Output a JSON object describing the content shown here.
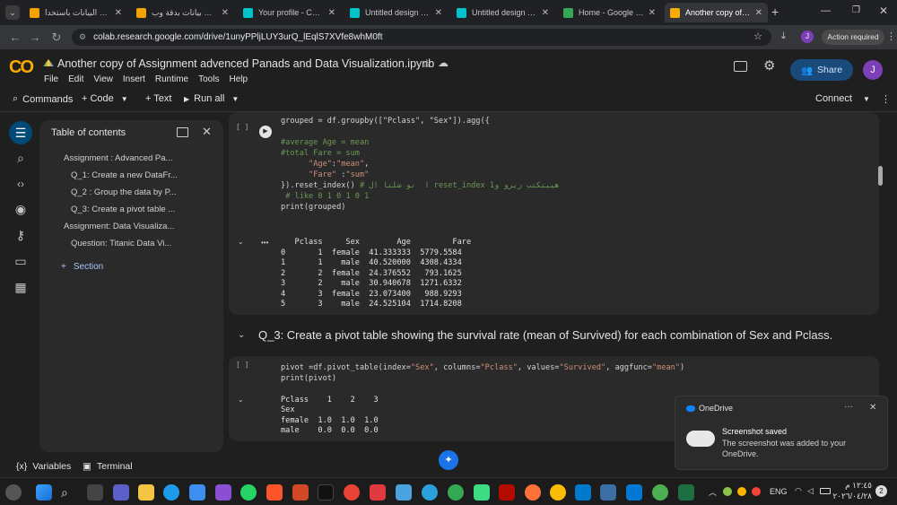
{
  "browser": {
    "tabs": [
      {
        "label": "تحليل البيانات باستخدا",
        "active": false,
        "favColor": "#f4a300"
      },
      {
        "label": "إدخال بيانات بدقة وب",
        "active": false,
        "favColor": "#f4a300"
      },
      {
        "label": "Your profile - Canva",
        "active": false,
        "favColor": "#00c4cc"
      },
      {
        "label": "Untitled design - 17(",
        "active": false,
        "favColor": "#00c4cc"
      },
      {
        "label": "Untitled design - 17(",
        "active": false,
        "favColor": "#00c4cc"
      },
      {
        "label": "Home - Google Drive",
        "active": false,
        "favColor": "#34a853"
      },
      {
        "label": "Another copy of Assi",
        "active": true,
        "favColor": "#f9ab00"
      }
    ],
    "url": "colab.research.google.com/drive/1unyPPljLUY3urQ_lEqlS7XVfe8whM0ft",
    "profile_initial": "J",
    "action_required": "Action required"
  },
  "colab": {
    "logo": "CO",
    "title": "Another copy of Assignment advenced Panads and Data Visualization.ipynb",
    "menu": [
      "File",
      "Edit",
      "View",
      "Insert",
      "Runtime",
      "Tools",
      "Help"
    ],
    "share_label": "Share",
    "user_initial": "J",
    "toolbar": {
      "commands": "Commands",
      "code": "+ Code",
      "text": "+ Text",
      "run_all": "Run all",
      "connect": "Connect"
    }
  },
  "toc": {
    "title": "Table of contents",
    "items": [
      {
        "label": "Assignment : Advanced Pa..."
      },
      {
        "label": "Q_1: Create a new DataFr..."
      },
      {
        "label": "Q_2 : Group the data by P..."
      },
      {
        "label": "Q_3: Create a pivot table ..."
      },
      {
        "label": "Assignment: Data Visualiza..."
      },
      {
        "label": "Question: Titanic Data Vi..."
      }
    ],
    "section_label": "Section"
  },
  "cell1": {
    "bracket": "[ ]",
    "output_dots": "•••",
    "table_header": "   Pclass     Sex        Age         Fare",
    "rows": [
      "0       1  female  41.333333  5779.5584",
      "1       1    male  40.520000  4308.4334",
      "2       2  female  24.376552   793.1625",
      "3       2    male  30.940678  1271.6332",
      "4       3  female  23.073400   988.9293",
      "5       3    male  24.525104  1714.8208"
    ]
  },
  "heading": "Q_3: Create a pivot table showing the survival rate (mean of Survived) for each combination of Sex and Pclass.",
  "cell2": {
    "bracket": "[ ]",
    "output_header": "Pclass    1    2    3",
    "output_index": "Sex",
    "output_rows": [
      "female  1.0  1.0  1.0",
      "male    0.0  0.0  0.0"
    ]
  },
  "statusbar": {
    "variables": "Variables",
    "terminal": "Terminal"
  },
  "toast": {
    "app": "OneDrive",
    "title": "Screenshot saved",
    "body": "The screenshot was added to your OneDrive."
  },
  "taskbar": {
    "lang": "ENG",
    "time": "١٢:٤٥ م",
    "date": "٢٠٢٦/٠٤/٢٨",
    "badge": "2"
  }
}
